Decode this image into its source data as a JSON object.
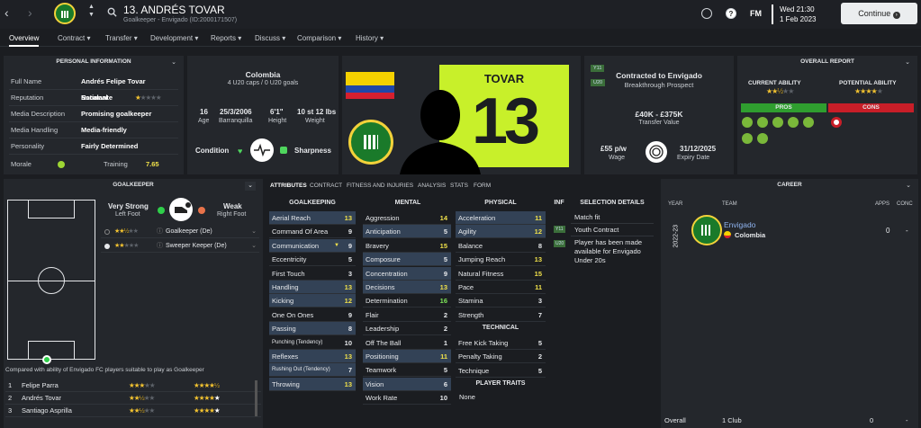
{
  "header": {
    "name": "13. ANDRÉS TOVAR",
    "subtitle": "Goalkeeper - Envigado (ID:2000171507)",
    "date": "Wed 21:30",
    "date2": "1 Feb 2023",
    "fm": "FM",
    "continue": "Continue"
  },
  "tabs": [
    "Overview",
    "Contract",
    "Transfer",
    "Development",
    "Reports",
    "Discuss",
    "Comparison",
    "History"
  ],
  "personal": {
    "title": "PERSONAL INFORMATION",
    "rows": [
      {
        "label": "Full Name",
        "value": "Andrés Felipe Tovar Escalante"
      },
      {
        "label": "Reputation",
        "value": "National"
      },
      {
        "label": "Media Description",
        "value": "Promising goalkeeper"
      },
      {
        "label": "Media Handling",
        "value": "Media-friendly"
      },
      {
        "label": "Personality",
        "value": "Fairly Determined"
      }
    ],
    "morale_label": "Morale",
    "training_label": "Training",
    "training_value": "7.65"
  },
  "info": {
    "nation": "Colombia",
    "caps": "4 U20 caps / 0 U20 goals",
    "stats": [
      {
        "v": "16",
        "l": "Age"
      },
      {
        "v": "25/3/2006",
        "l": "Barranquilla"
      },
      {
        "v": "6'1\"",
        "l": "Height"
      },
      {
        "v": "10 st 12 lbs",
        "l": "Weight"
      }
    ],
    "condition": "Condition",
    "sharpness": "Sharpness"
  },
  "kit": {
    "name": "TOVAR",
    "number": "13"
  },
  "contract": {
    "title": "Contracted to Envigado",
    "subtitle": "Breakthrough Prospect",
    "tag1": "Y11",
    "tag2": "U20",
    "value": "£40K - £375K",
    "value_label": "Transfer Value",
    "wage": "£55 p/w",
    "wage_label": "Wage",
    "expiry": "31/12/2025",
    "expiry_label": "Expiry Date"
  },
  "report": {
    "title": "OVERALL REPORT",
    "current": "CURRENT ABILITY",
    "potential": "POTENTIAL ABILITY",
    "current_stars": 2.5,
    "potential_stars": 4,
    "pros": "PROS",
    "cons": "CONS"
  },
  "gk": {
    "title": "GOALKEEPER",
    "foot1": "Very Strong",
    "foot1_label": "Left Foot",
    "foot2": "Weak",
    "foot2_label": "Right Foot",
    "roles": [
      {
        "name": "Goalkeeper (De)",
        "stars": 2.5
      },
      {
        "name": "Sweeper Keeper (De)",
        "stars": 2
      }
    ],
    "compare": "Compared with ability of Envigado FC players suitable to play as Goalkeeper",
    "list": [
      {
        "pos": "1",
        "name": "Felipe Parra",
        "ca": 3,
        "pa": 4.5
      },
      {
        "pos": "2",
        "name": "Andrés Tovar",
        "ca": 2.5,
        "pa": 4
      },
      {
        "pos": "3",
        "name": "Santiago Asprilla",
        "ca": 2.5,
        "pa": 4
      }
    ]
  },
  "attr_tabs": [
    "ATTRIBUTES",
    "CONTRACT",
    "FITNESS AND INJURIES",
    "ANALYSIS",
    "STATS",
    "FORM"
  ],
  "attrs": {
    "gk_head": "GOALKEEPING",
    "mental_head": "MENTAL",
    "phys_head": "PHYSICAL",
    "inf_head": "INF",
    "sel_head": "SELECTION DETAILS",
    "tech_head": "TECHNICAL",
    "traits_head": "PLAYER TRAITS",
    "traits": "None",
    "gk": [
      [
        "Aerial Reach",
        "13"
      ],
      [
        "Command Of Area",
        "9"
      ],
      [
        "Communication",
        "9"
      ],
      [
        "Eccentricity",
        "5"
      ],
      [
        "First Touch",
        "3"
      ],
      [
        "Handling",
        "13"
      ],
      [
        "Kicking",
        "12"
      ],
      [
        "One On Ones",
        "9"
      ],
      [
        "Passing",
        "8"
      ],
      [
        "Punching (Tendency)",
        "10"
      ],
      [
        "Reflexes",
        "13"
      ],
      [
        "Rushing Out (Tendency)",
        "7"
      ],
      [
        "Throwing",
        "13"
      ]
    ],
    "mental": [
      [
        "Aggression",
        "14"
      ],
      [
        "Anticipation",
        "5"
      ],
      [
        "Bravery",
        "15"
      ],
      [
        "Composure",
        "5"
      ],
      [
        "Concentration",
        "9"
      ],
      [
        "Decisions",
        "13"
      ],
      [
        "Determination",
        "16"
      ],
      [
        "Flair",
        "2"
      ],
      [
        "Leadership",
        "2"
      ],
      [
        "Off The Ball",
        "1"
      ],
      [
        "Positioning",
        "11"
      ],
      [
        "Teamwork",
        "5"
      ],
      [
        "Vision",
        "6"
      ],
      [
        "Work Rate",
        "10"
      ]
    ],
    "physical": [
      [
        "Acceleration",
        "11"
      ],
      [
        "Agility",
        "12"
      ],
      [
        "Balance",
        "8"
      ],
      [
        "Jumping Reach",
        "13"
      ],
      [
        "Natural Fitness",
        "15"
      ],
      [
        "Pace",
        "11"
      ],
      [
        "Stamina",
        "3"
      ],
      [
        "Strength",
        "7"
      ]
    ],
    "technical": [
      [
        "Free Kick Taking",
        "5"
      ],
      [
        "Penalty Taking",
        "2"
      ],
      [
        "Technique",
        "5"
      ]
    ],
    "selection": [
      {
        "tag": "",
        "text": "Match fit"
      },
      {
        "tag": "Y11",
        "text": "Youth Contract"
      },
      {
        "tag": "U20",
        "text": "Player has been made available for Envigado Under 20s"
      }
    ]
  },
  "career": {
    "title": "CAREER",
    "cols": [
      "YEAR",
      "TEAM",
      "APPS",
      "CONC"
    ],
    "year": "2022-23",
    "team": "Envigado",
    "nation": "Colombia",
    "apps": "0",
    "conc": "-",
    "overall": "Overall",
    "clubs": "1 Club",
    "oapps": "0",
    "oconc": "-"
  },
  "colors": {
    "accent": "#f0e14a",
    "green": "#7fe65a",
    "blue_row": "#334256",
    "kit": "#c8f02a"
  }
}
